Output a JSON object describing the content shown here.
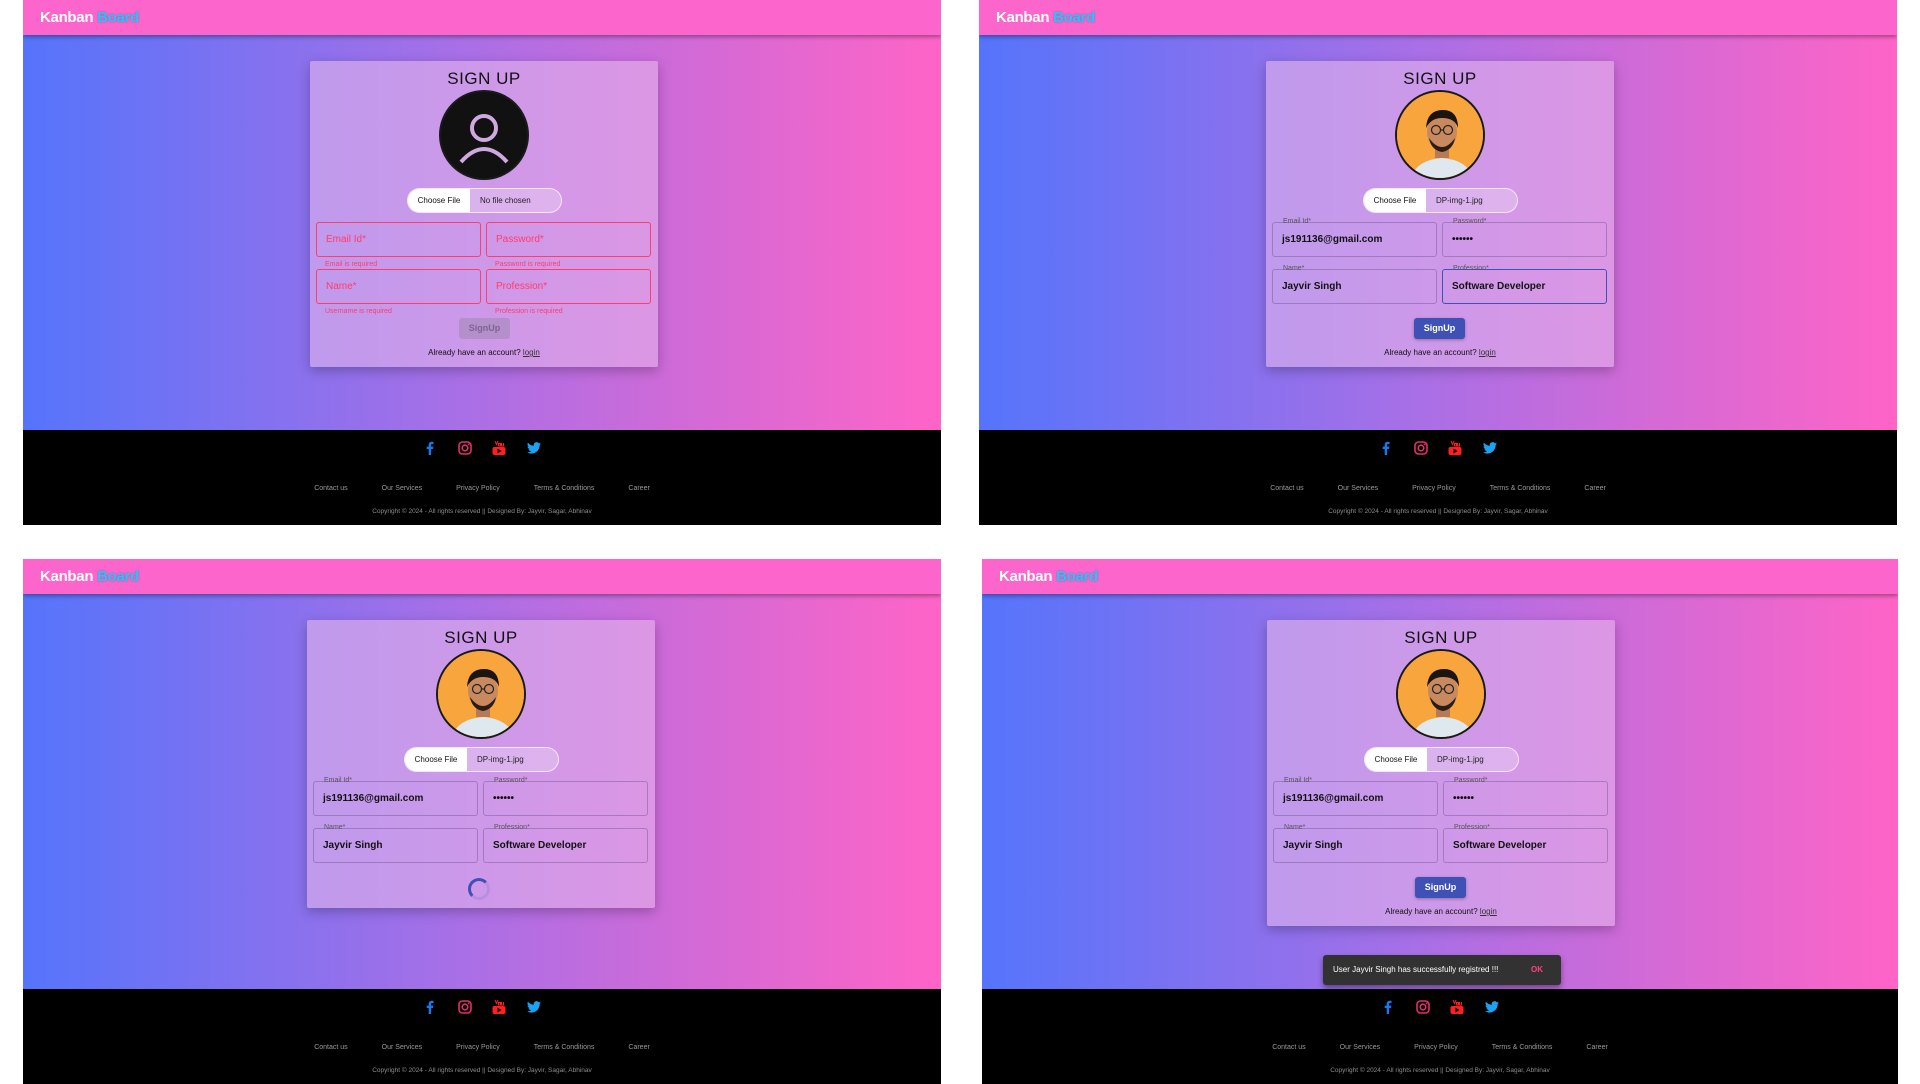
{
  "brand": {
    "name": "Kanban",
    "accent": "Board",
    "header_color": "#fc66cc",
    "accent_color": "#1ec8ff"
  },
  "form": {
    "title": "SIGN UP",
    "choose_file": "Choose File",
    "no_file": "No file chosen",
    "file_name": "DP-img-1.jpg",
    "email_label": "Email Id*",
    "password_label": "Password*",
    "name_label": "Name*",
    "profession_label": "Profession*",
    "email_value": "js191136@gmail.com",
    "password_value": "••••••",
    "name_value": "Jayvir Singh",
    "profession_value": "Software Developer",
    "email_error": "Email is required",
    "password_error": "Password is required",
    "name_error": "Username is required",
    "profession_error": "Profession is required",
    "submit": "SignUp",
    "login_prompt": "Already have an account?",
    "login_link": "login",
    "button_color": "#3f51b5",
    "error_color": "#ff3d6a"
  },
  "footer": {
    "social_icons": [
      "facebook-icon",
      "instagram-icon",
      "youtube-icon",
      "twitter-icon"
    ],
    "links": [
      "Contact us",
      "Our Services",
      "Privacy Policy",
      "Terms & Conditions",
      "Career"
    ],
    "copyright": "Copyright © 2024 - All rights reserved || Designed By: Jayvir, Sagar, Abhinav"
  },
  "snackbar": {
    "message": "User Jayvir Singh has successfully registred !!!",
    "action": "OK"
  }
}
